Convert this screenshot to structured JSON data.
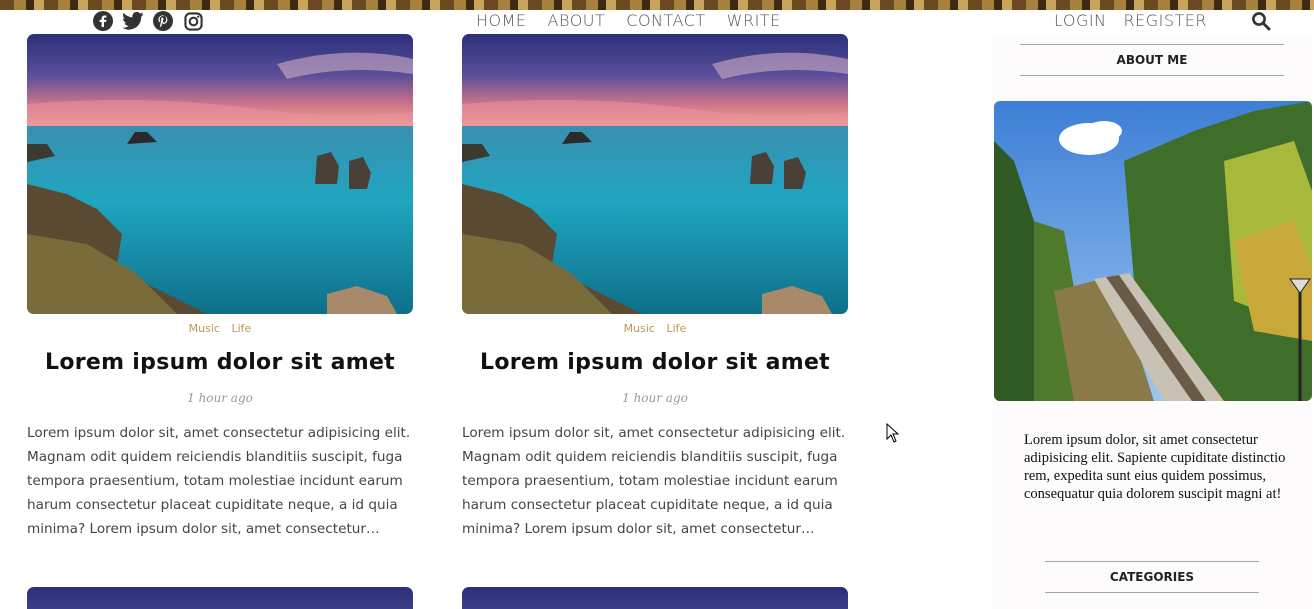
{
  "nav": {
    "social_icons": [
      "facebook-icon",
      "twitter-icon",
      "pinterest-icon",
      "instagram-icon"
    ],
    "links": [
      "HOME",
      "ABOUT",
      "CONTACT",
      "WRITE"
    ],
    "auth": [
      "LOGIN",
      "REGISTER"
    ],
    "search_icon": "search-icon"
  },
  "posts": [
    {
      "categories": [
        "Music",
        "Life"
      ],
      "title": "Lorem ipsum dolor sit amet",
      "date": "1 hour ago",
      "desc": "Lorem ipsum dolor sit, amet consectetur adipisicing elit. Magnam odit quidem reiciendis blanditiis suscipit, fuga tempora praesentium, totam molestiae incidunt earum harum consectetur placeat cupiditate neque, a id quia minima? Lorem ipsum dolor sit, amet consectetur…"
    },
    {
      "categories": [
        "Music",
        "Life"
      ],
      "title": "Lorem ipsum dolor sit amet",
      "date": "1 hour ago",
      "desc": "Lorem ipsum dolor sit, amet consectetur adipisicing elit. Magnam odit quidem reiciendis blanditiis suscipit, fuga tempora praesentium, totam molestiae incidunt earum harum consectetur placeat cupiditate neque, a id quia minima? Lorem ipsum dolor sit, amet consectetur…"
    }
  ],
  "sidebar": {
    "about_title": "ABOUT ME",
    "about_text": "Lorem ipsum dolor, sit amet consectetur adipisicing elit. Sapiente cupiditate distinctio rem, expedita sunt eius quidem possimus, consequatur quia dolorem suscipit magni at!",
    "categories_title": "CATEGORIES"
  },
  "colors": {
    "category": "#be9656",
    "title": "#111111",
    "sidebar_bg": "#fdfbfb"
  }
}
